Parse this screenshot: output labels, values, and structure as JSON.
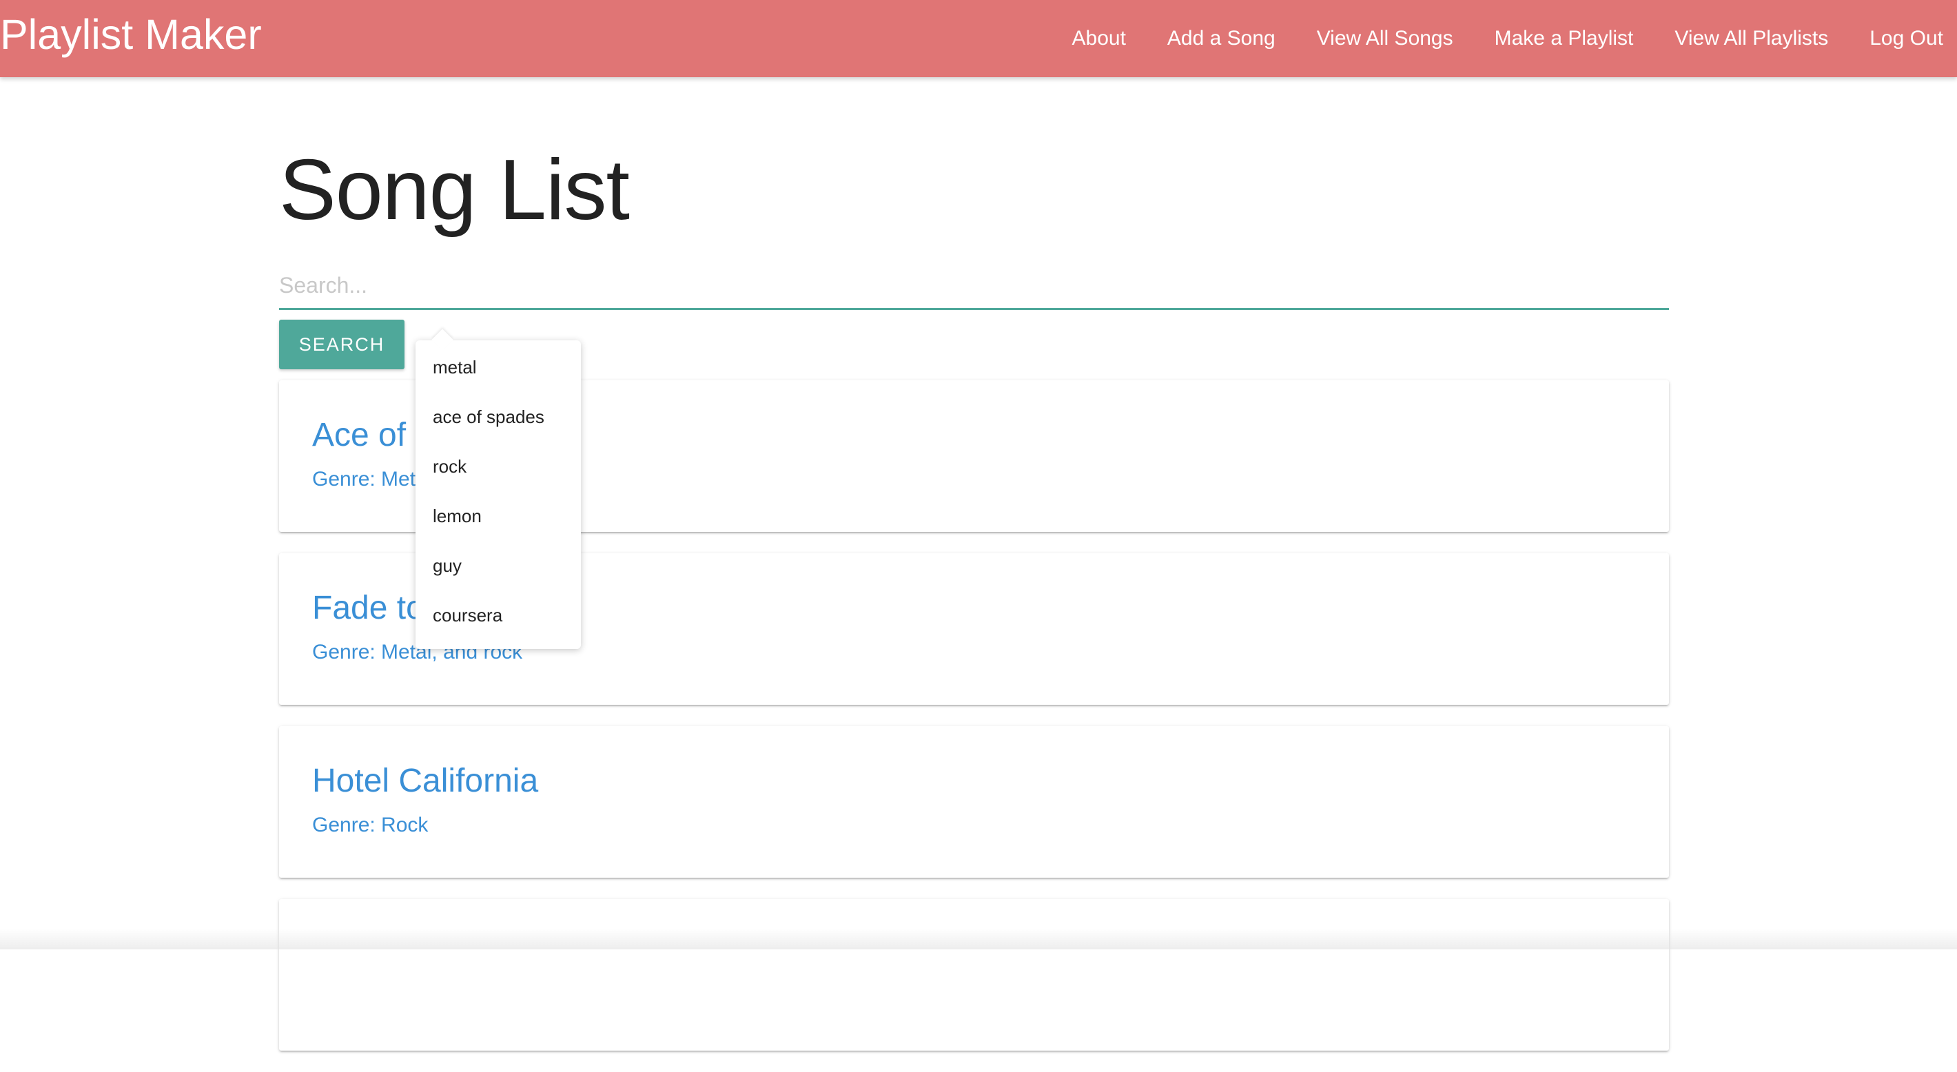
{
  "navbar": {
    "brand": "Playlist Maker",
    "links": [
      {
        "label": "About"
      },
      {
        "label": "Add a Song"
      },
      {
        "label": "View All Songs"
      },
      {
        "label": "Make a Playlist"
      },
      {
        "label": "View All Playlists"
      },
      {
        "label": "Log Out"
      }
    ],
    "color": "#e07575"
  },
  "main": {
    "title": "Song List",
    "search": {
      "placeholder": "Search...",
      "value": "",
      "button_label": "Search"
    },
    "songs": [
      {
        "title": "Ace of Spades",
        "genre": "Genre: Metal"
      },
      {
        "title": "Fade to Black",
        "genre": "Genre: Metal, and rock"
      },
      {
        "title": "Hotel California",
        "genre": "Genre: Rock"
      }
    ]
  },
  "autocomplete": {
    "options": [
      "metal",
      "ace of spades",
      "rock",
      "lemon",
      "guy",
      "coursera"
    ]
  },
  "colors": {
    "accent": "#4fa89a",
    "link": "#3a8fd6"
  }
}
